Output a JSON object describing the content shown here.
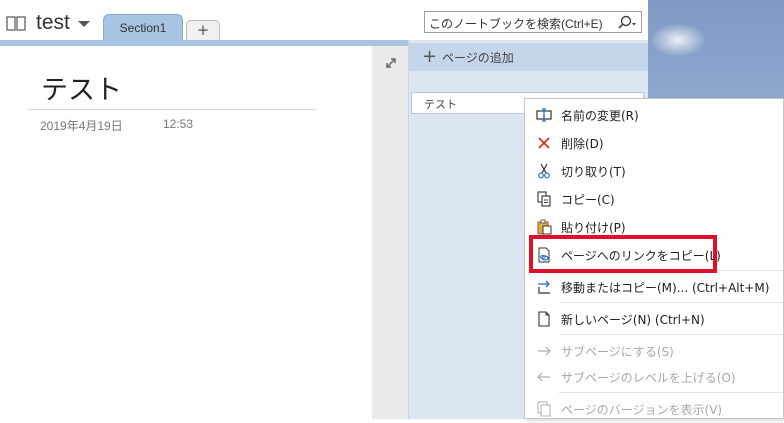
{
  "notebook": {
    "title": "test"
  },
  "tabs": {
    "section_label": "Section1",
    "add_label": "+"
  },
  "search": {
    "placeholder": "このノートブックを検索(Ctrl+E)"
  },
  "pages_panel": {
    "add_page_label": "ページの追加",
    "add_page_plus": "+",
    "items": [
      {
        "label": "テスト"
      }
    ]
  },
  "page": {
    "title": "テスト",
    "date": "2019年4月19日",
    "time": "12:53"
  },
  "context_menu": {
    "items": [
      {
        "label": "名前の変更(R)",
        "icon": "rename-icon",
        "enabled": true
      },
      {
        "label": "削除(D)",
        "icon": "delete-icon",
        "enabled": true
      },
      {
        "label": "切り取り(T)",
        "icon": "scissors-icon",
        "enabled": true
      },
      {
        "label": "コピー(C)",
        "icon": "copy-icon",
        "enabled": true
      },
      {
        "label": "貼り付け(P)",
        "icon": "paste-icon",
        "enabled": true
      },
      {
        "label": "ページへのリンクをコピー(L)",
        "icon": "copy-link-icon",
        "enabled": true
      },
      {
        "label": "移動またはコピー(M)...  (Ctrl+Alt+M)",
        "icon": "move-copy-icon",
        "enabled": true
      },
      {
        "label": "新しいページ(N)  (Ctrl+N)",
        "icon": "new-page-icon",
        "enabled": true
      },
      {
        "label": "サブページにする(S)",
        "icon": "arrow-right-icon",
        "enabled": false
      },
      {
        "label": "サブページのレベルを上げる(O)",
        "icon": "arrow-left-icon",
        "enabled": false
      },
      {
        "label": "ページのバージョンを表示(V)",
        "icon": "page-versions-icon",
        "enabled": false
      }
    ]
  },
  "colors": {
    "accent": "#a9c3e2",
    "highlight": "#e0102a",
    "panel": "#dce6f2"
  }
}
